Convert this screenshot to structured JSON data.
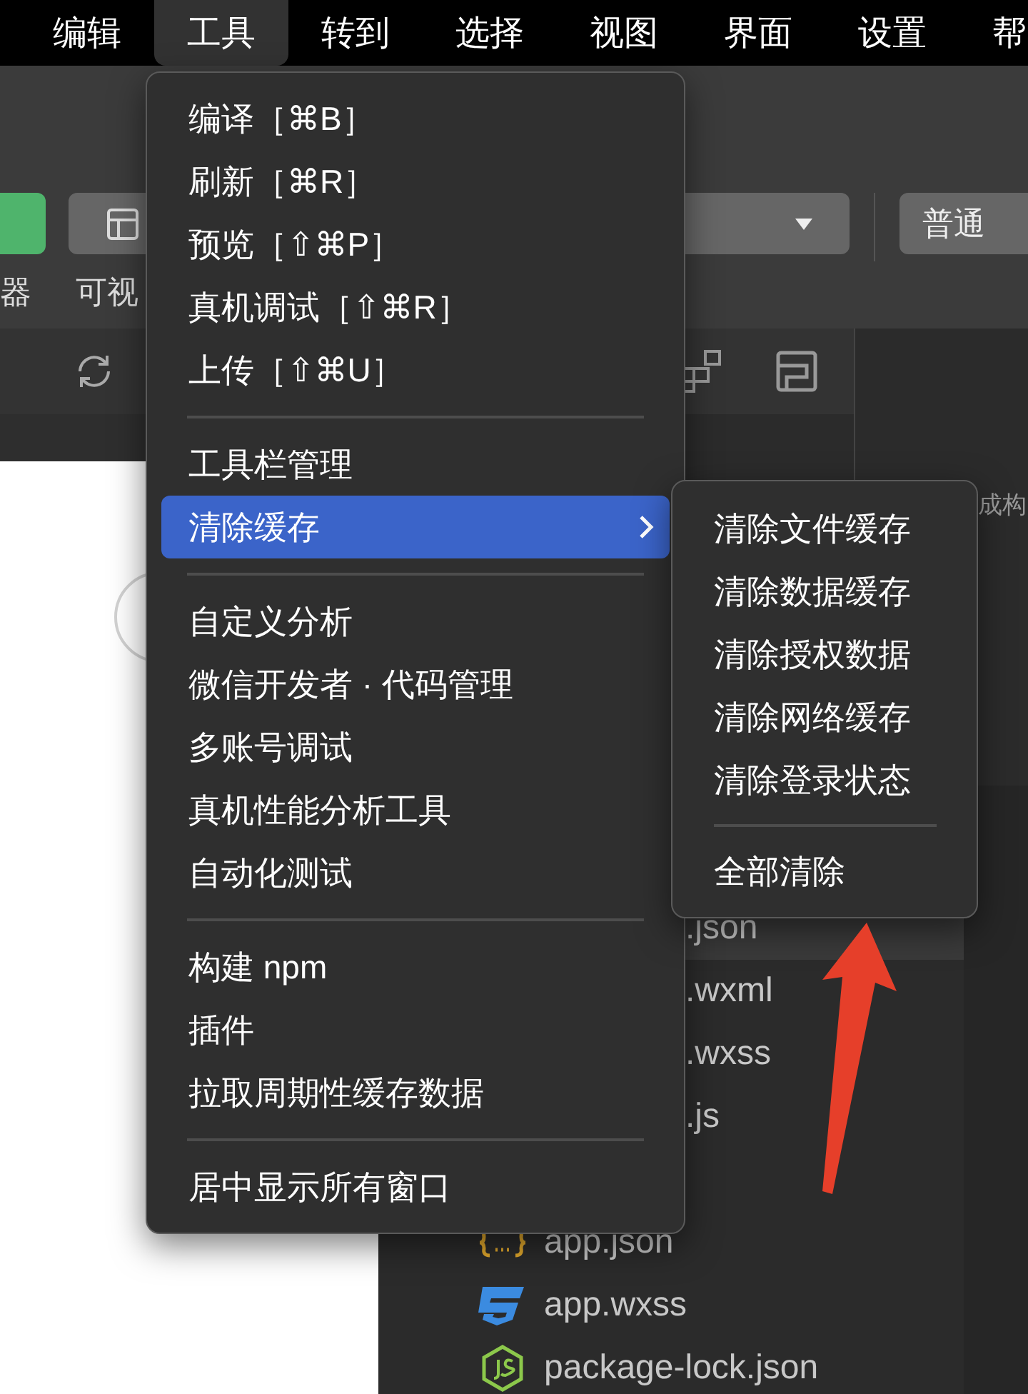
{
  "menu_bar": {
    "items": [
      {
        "label": "编辑",
        "selected": false
      },
      {
        "label": "工具",
        "selected": true
      },
      {
        "label": "转到",
        "selected": false
      },
      {
        "label": "选择",
        "selected": false
      },
      {
        "label": "视图",
        "selected": false
      },
      {
        "label": "界面",
        "selected": false
      },
      {
        "label": "设置",
        "selected": false
      },
      {
        "label": "帮",
        "selected": false
      }
    ]
  },
  "toolbar": {
    "buttons": [
      {
        "kind": "green",
        "label": "器"
      },
      {
        "kind": "layout",
        "label": "可视"
      }
    ],
    "dropdown": {
      "open": false
    },
    "mode_button": {
      "label": "普通"
    }
  },
  "side_panel": {
    "text": "成构"
  },
  "file_tree": {
    "items": [
      {
        "name": ".json",
        "selected": true,
        "kind": "partial"
      },
      {
        "name": ".wxml",
        "selected": false,
        "kind": "partial"
      },
      {
        "name": ".wxss",
        "selected": false,
        "kind": "partial"
      },
      {
        "name": ".js",
        "selected": false,
        "kind": "partial"
      },
      {
        "name": "app.json",
        "selected": false,
        "kind": "json"
      },
      {
        "name": "app.wxss",
        "selected": false,
        "kind": "css"
      },
      {
        "name": "package-lock.json",
        "selected": false,
        "kind": "node"
      }
    ]
  },
  "tools_menu": {
    "groups": [
      [
        {
          "label": "编译［⌘B］",
          "selected": false,
          "submenu": false
        },
        {
          "label": "刷新［⌘R］",
          "selected": false,
          "submenu": false
        },
        {
          "label": "预览［⇧⌘P］",
          "selected": false,
          "submenu": false
        },
        {
          "label": "真机调试［⇧⌘R］",
          "selected": false,
          "submenu": false
        },
        {
          "label": "上传［⇧⌘U］",
          "selected": false,
          "submenu": false
        }
      ],
      [
        {
          "label": "工具栏管理",
          "selected": false,
          "submenu": false
        },
        {
          "label": "清除缓存",
          "selected": true,
          "submenu": true
        }
      ],
      [
        {
          "label": "自定义分析",
          "selected": false,
          "submenu": false
        },
        {
          "label": "微信开发者 · 代码管理",
          "selected": false,
          "submenu": false
        },
        {
          "label": "多账号调试",
          "selected": false,
          "submenu": false
        },
        {
          "label": "真机性能分析工具",
          "selected": false,
          "submenu": false
        },
        {
          "label": "自动化测试",
          "selected": false,
          "submenu": false
        }
      ],
      [
        {
          "label": "构建 npm",
          "selected": false,
          "submenu": false
        },
        {
          "label": "插件",
          "selected": false,
          "submenu": false
        },
        {
          "label": "拉取周期性缓存数据",
          "selected": false,
          "submenu": false
        }
      ],
      [
        {
          "label": "居中显示所有窗口",
          "selected": false,
          "submenu": false
        }
      ]
    ]
  },
  "clear_cache_submenu": {
    "groups": [
      [
        {
          "label": "清除文件缓存",
          "selected": false
        },
        {
          "label": "清除数据缓存",
          "selected": false
        },
        {
          "label": "清除授权数据",
          "selected": false
        },
        {
          "label": "清除网络缓存",
          "selected": false
        },
        {
          "label": "清除登录状态",
          "selected": false
        }
      ],
      [
        {
          "label": "全部清除",
          "selected": false
        }
      ]
    ]
  }
}
